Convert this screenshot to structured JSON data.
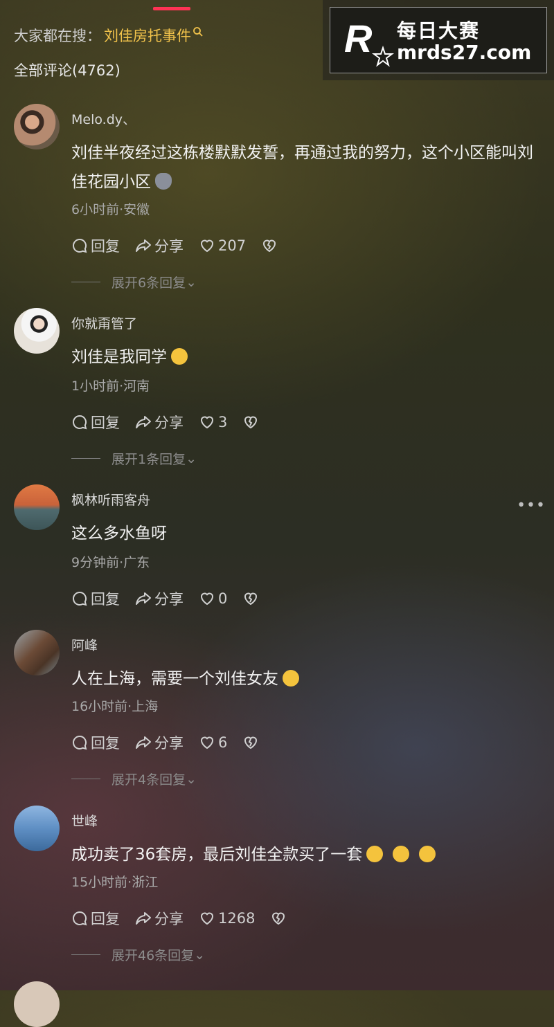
{
  "header": {
    "search_prefix": "大家都在搜：",
    "search_keyword": "刘佳房托事件",
    "comment_count_label": "全部评论(4762)"
  },
  "watermark": {
    "name": "每日大赛",
    "url": "mrds27.com"
  },
  "action_labels": {
    "reply": "回复",
    "share": "分享"
  },
  "comments": [
    {
      "username": "Melo.dy、",
      "text": "刘佳半夜经过这栋楼默默发誓，再通过我的努力，这个小区能叫刘佳花园小区",
      "emoji": "cat-emoji",
      "meta": "6小时前·安徽",
      "likes": "207",
      "expand": "展开6条回复"
    },
    {
      "username": "你就甭管了",
      "text": "刘佳是我同学",
      "emoji": "sweat-smile-emoji",
      "meta": "1小时前·河南",
      "likes": "3",
      "expand": "展开1条回复"
    },
    {
      "username": "枫林听雨客舟",
      "text": "这么多水鱼呀",
      "emoji": "",
      "meta": "9分钟前·广东",
      "likes": "0",
      "expand": ""
    },
    {
      "username": "阿峰",
      "text": "人在上海，需要一个刘佳女友",
      "emoji": "smile-emoji",
      "meta": "16小时前·上海",
      "likes": "6",
      "expand": "展开4条回复"
    },
    {
      "username": "世峰",
      "text": "成功卖了36套房，最后刘佳全款买了一套",
      "emoji": "laugh-cry-emoji-x3",
      "meta": "15小时前·浙江",
      "likes": "1268",
      "expand": "展开46条回复"
    }
  ],
  "colors": {
    "accent_red": "#ff3355",
    "keyword_yellow": "#f1c24b"
  }
}
